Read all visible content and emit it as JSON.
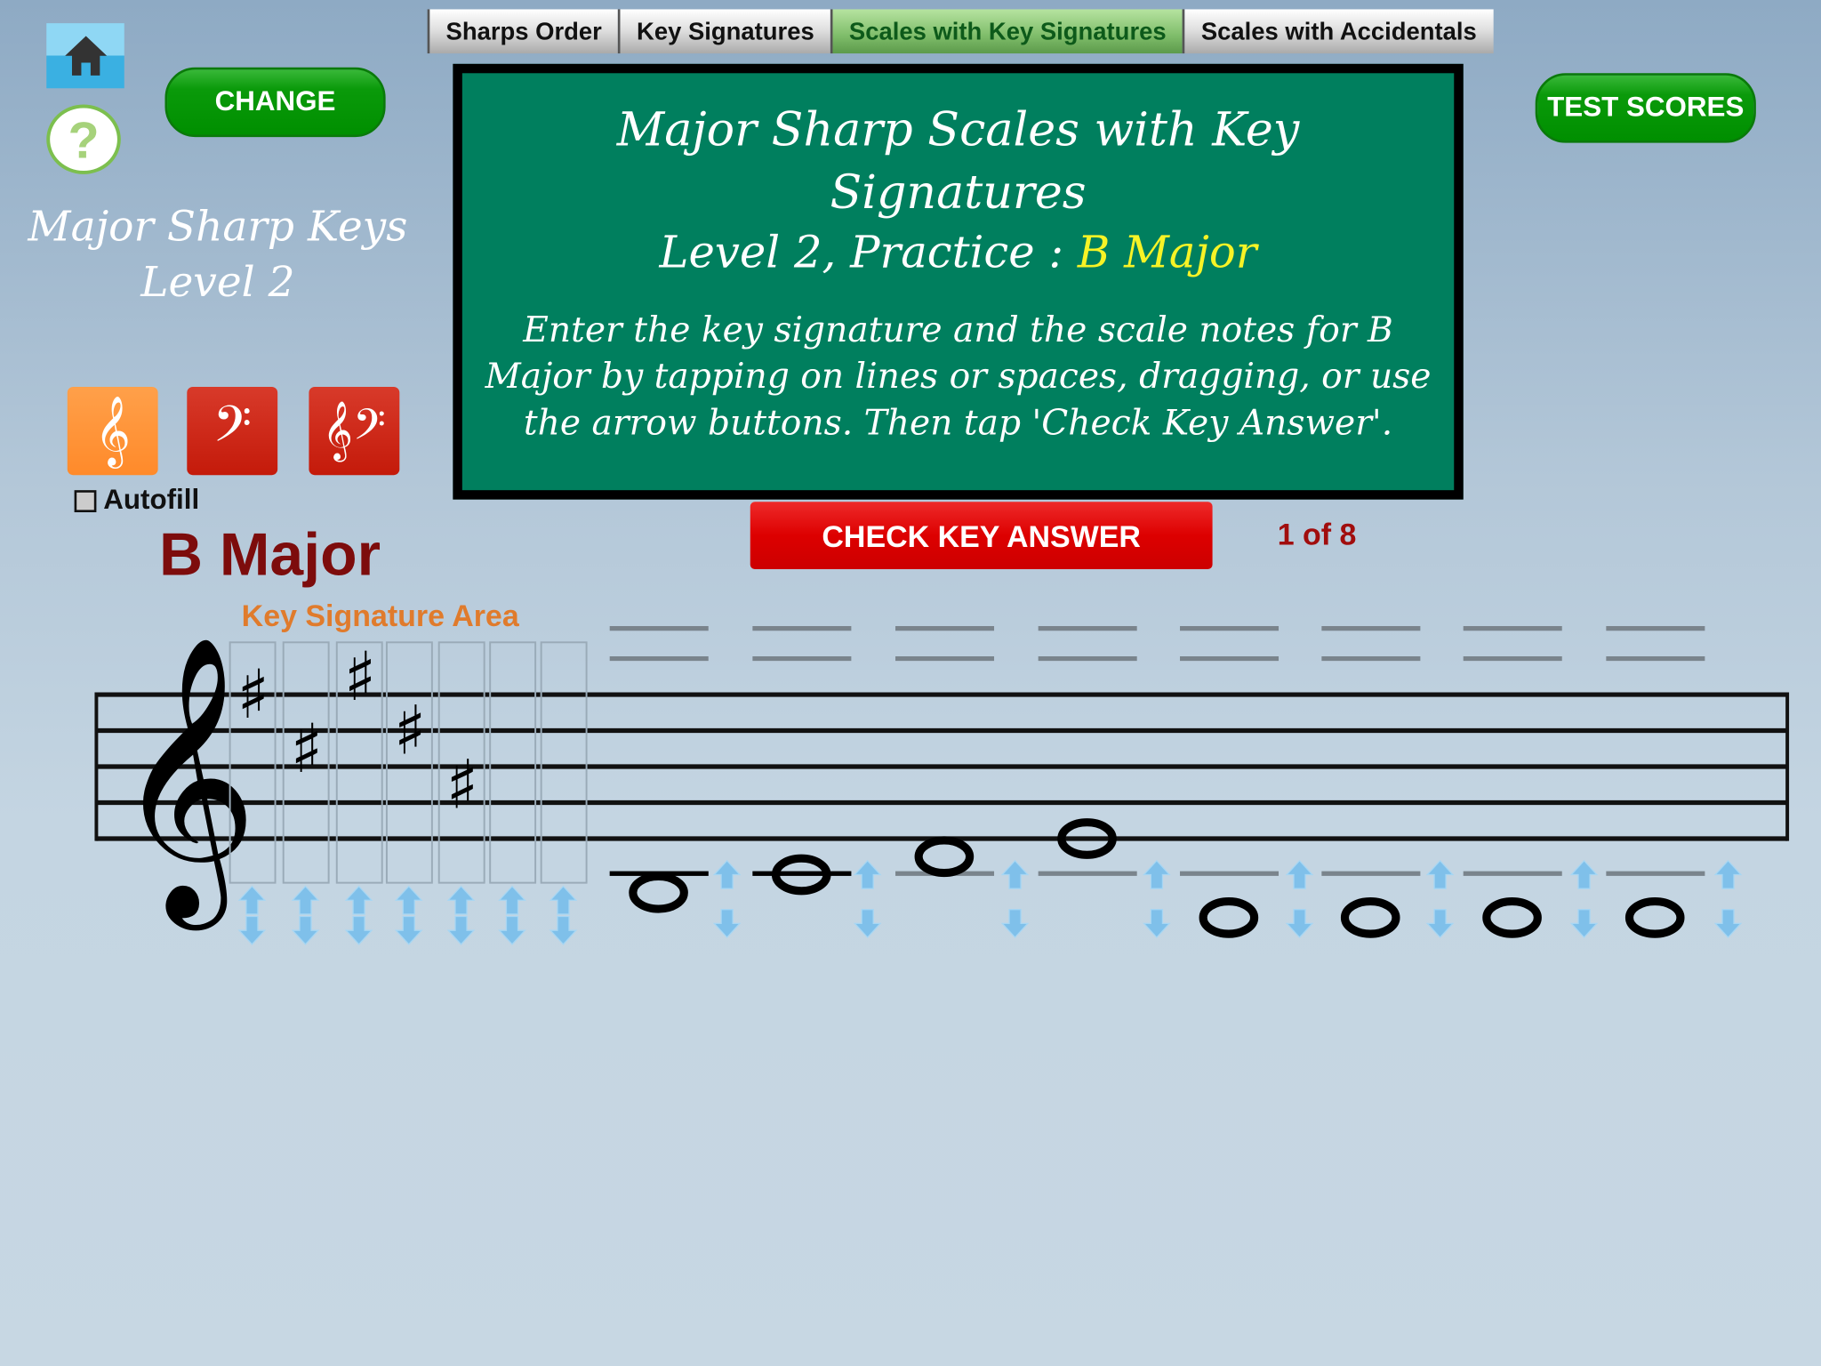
{
  "tabs": [
    {
      "label": "Sharps Order",
      "active": false
    },
    {
      "label": "Key Signatures",
      "active": false
    },
    {
      "label": "Scales with Key Signatures",
      "active": true
    },
    {
      "label": "Scales with Accidentals",
      "active": false
    }
  ],
  "buttons": {
    "change": "CHANGE",
    "test_scores": "TEST SCORES",
    "check_key_answer": "CHECK KEY ANSWER",
    "help_symbol": "?"
  },
  "sidebar": {
    "title_line1": "Major Sharp Keys",
    "title_line2": "Level 2",
    "autofill_label": "Autofill",
    "autofill_checked": false,
    "clef_buttons": [
      {
        "name": "treble-clef",
        "glyph": "𝄞",
        "color": "#ff8a2a",
        "selected": true
      },
      {
        "name": "bass-clef",
        "glyph": "𝄢",
        "color": "#c41a0a",
        "selected": false
      },
      {
        "name": "grand-staff",
        "glyph": "𝄞𝄢",
        "color": "#c41a0a",
        "selected": false
      }
    ]
  },
  "board": {
    "title": "Major Sharp Scales with Key Signatures",
    "subtitle_prefix": "Level 2, Practice : ",
    "subtitle_key": "B Major",
    "instructions": "Enter the key signature and the scale notes for B Major by tapping on lines or spaces, dragging, or use the arrow buttons. Then tap 'Check Key Answer'."
  },
  "progress": "1 of 8",
  "key_name": "B Major",
  "key_signature_area_label": "Key Signature Area",
  "staff": {
    "clef": "treble",
    "key_signature_sharps": [
      "F#5",
      "C#5",
      "G#5",
      "D#5",
      "A#4"
    ],
    "key_signature_slots": 7,
    "scale_notes": [
      {
        "note": "B3",
        "placed": true
      },
      {
        "note": "C4",
        "placed": true
      },
      {
        "note": "D4",
        "placed": true
      },
      {
        "note": "E4",
        "placed": true
      },
      {
        "note": null,
        "placed": false
      },
      {
        "note": null,
        "placed": false
      },
      {
        "note": null,
        "placed": false
      },
      {
        "note": null,
        "placed": false
      }
    ]
  },
  "colors": {
    "chalkboard": "#007f5e",
    "highlight_text": "#f7f326",
    "key_name": "#7d0c0c",
    "check_button": "#d00000",
    "arrow": "#7fc0ea"
  }
}
